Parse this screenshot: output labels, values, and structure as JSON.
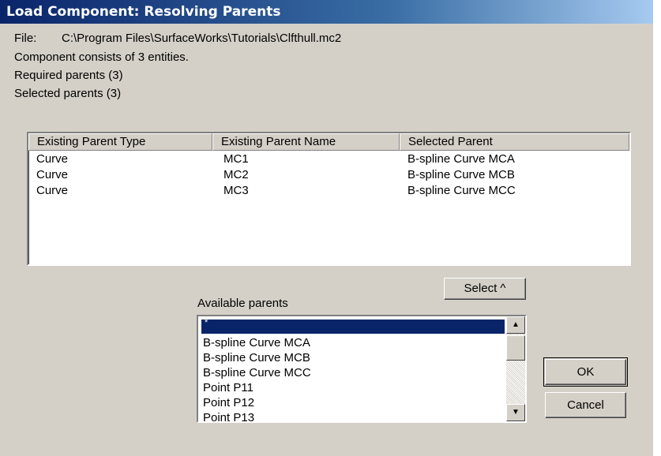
{
  "window": {
    "title": "Load Component: Resolving Parents"
  },
  "info": {
    "file_label": "File:",
    "file_path": "C:\\Program Files\\SurfaceWorks\\Tutorials\\Clfthull.mc2",
    "entities": "Component consists of 3 entities.",
    "required": "Required parents (3)",
    "selected": "Selected parents (3)"
  },
  "table": {
    "columns": [
      "Existing Parent Type",
      "Existing Parent Name",
      "Selected Parent"
    ],
    "rows": [
      [
        "Curve",
        "MC1",
        "B-spline Curve MCA"
      ],
      [
        "Curve",
        "MC2",
        "B-spline Curve MCB"
      ],
      [
        "Curve",
        "MC3",
        "B-spline Curve MCC"
      ]
    ]
  },
  "select_button": "Select ^",
  "available": {
    "label": "Available parents",
    "selected_item": "*",
    "items": [
      "B-spline Curve MCA",
      "B-spline Curve MCB",
      "B-spline Curve MCC",
      "Point P11",
      "Point P12",
      "Point P13"
    ]
  },
  "buttons": {
    "ok": "OK",
    "cancel": "Cancel"
  },
  "icons": {
    "scroll_up": "scroll-up-arrow-icon",
    "scroll_down": "scroll-down-arrow-icon"
  }
}
